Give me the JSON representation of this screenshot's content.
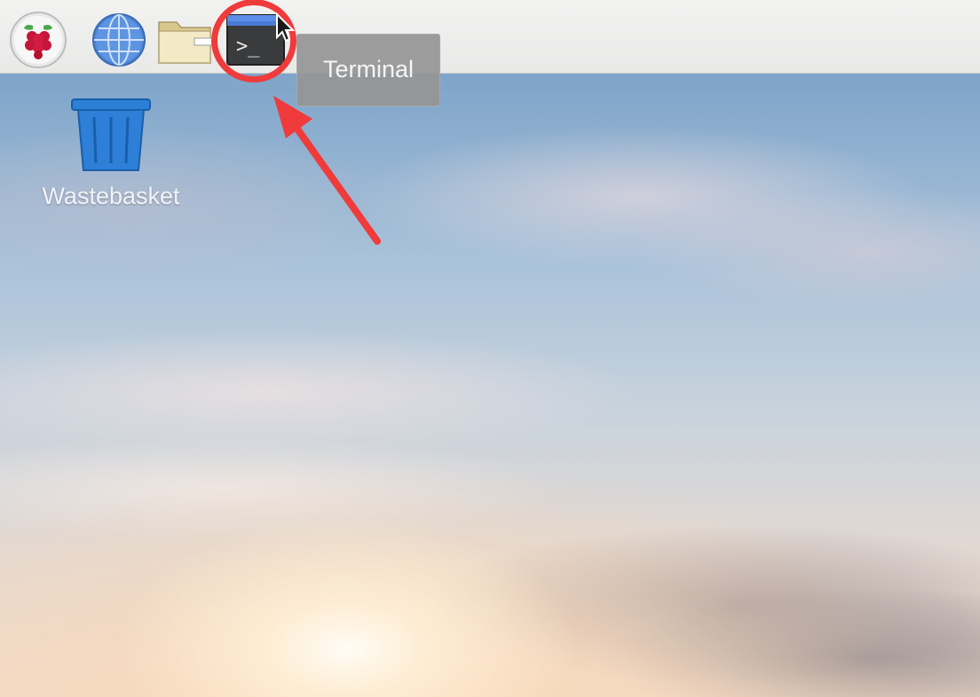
{
  "taskbar": {
    "launchers": [
      {
        "name": "raspberry-pi-menu",
        "icon": "raspberry-icon"
      },
      {
        "name": "web-browser",
        "icon": "globe-icon"
      },
      {
        "name": "file-manager",
        "icon": "folder-icon"
      },
      {
        "name": "terminal",
        "icon": "terminal-icon",
        "glyph": ">_"
      }
    ]
  },
  "tooltip": {
    "text": "Terminal"
  },
  "desktop": {
    "icons": [
      {
        "label": "Wastebasket",
        "icon": "trash-bin-icon"
      }
    ]
  },
  "annotation": {
    "color": "#ef3b3b"
  }
}
